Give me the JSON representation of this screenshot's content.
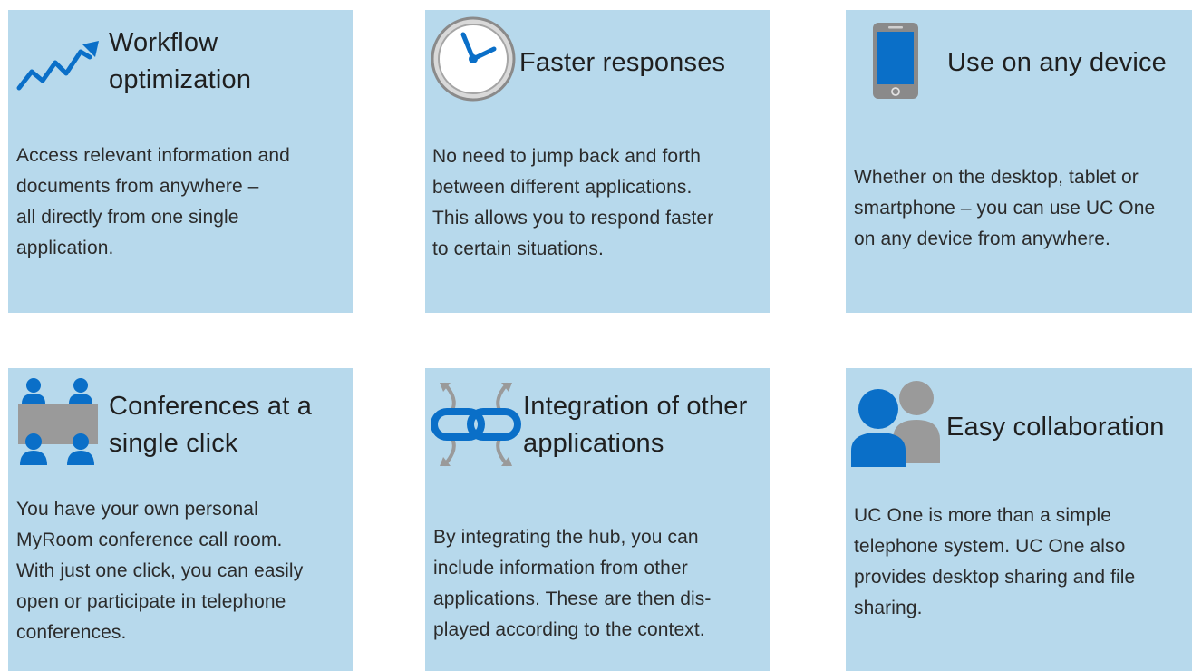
{
  "cards": [
    {
      "title_line1": "Workflow",
      "title_line2": "optimization",
      "lines": [
        "Access relevant information and",
        "documents from anywhere  –",
        "all directly from one single",
        "application."
      ],
      "icon": "trend-arrow-icon"
    },
    {
      "title_line1": "Faster responses",
      "lines": [
        "No need to jump back and forth",
        "between different applications.",
        "This allows you to respond faster",
        "to certain situations."
      ],
      "icon": "clock-icon"
    },
    {
      "title_line1": "Use on any device",
      "lines": [
        "Whether on the desktop, tablet or",
        "smartphone – you can use UC One",
        "on any device from anywhere."
      ],
      "icon": "smartphone-icon"
    },
    {
      "title_line1": "Conferences at a",
      "title_line2": "single click",
      "lines": [
        "You have your own personal",
        "MyRoom conference call room.",
        "With just one click, you can easily",
        "open or participate in telephone",
        "conferences."
      ],
      "icon": "conference-icon"
    },
    {
      "title_line1": "Integration of other",
      "title_line2": "applications",
      "lines": [
        "By integrating the hub, you can",
        "include information from other",
        "applications. These are then dis-",
        "played according to the context."
      ],
      "icon": "chain-link-icon"
    },
    {
      "title_line1": "Easy collaboration",
      "lines": [
        "UC One is more than a simple",
        "telephone system. UC One also",
        "provides desktop sharing and file",
        "sharing."
      ],
      "icon": "collaboration-icon"
    }
  ],
  "colors": {
    "card_bg": "#b7d9ec",
    "icon_blue": "#0a6fc8",
    "icon_gray": "#8a8a8a"
  }
}
